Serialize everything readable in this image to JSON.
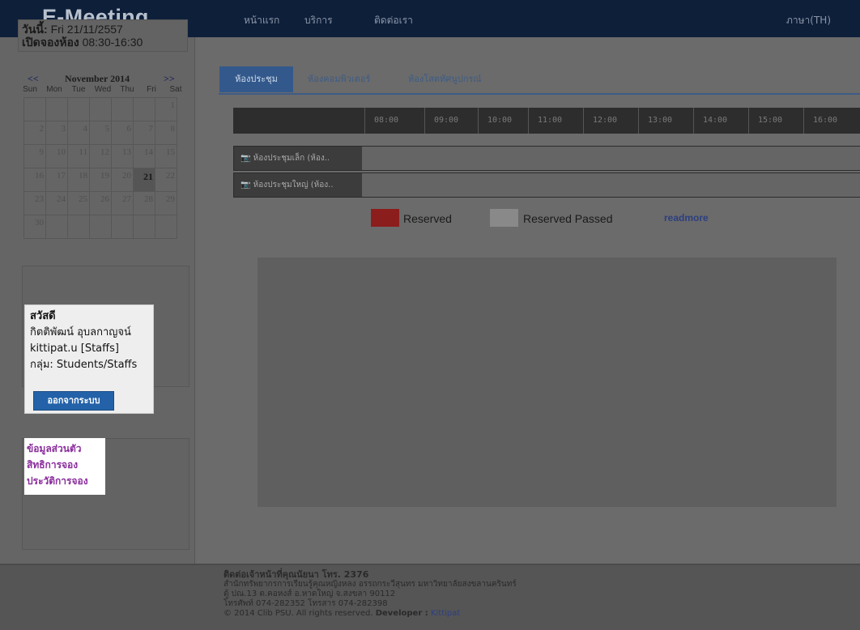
{
  "header": {
    "logo": "E-Meeting",
    "nav": [
      "หน้าแรก",
      "บริการ",
      "ติดต่อเรา"
    ],
    "language": "ภาษา(TH)"
  },
  "datebox": {
    "today_label": "วันนี้:",
    "today_value": "Fri 21/11/2557",
    "open_label": "เปิดจองห้อง",
    "open_value": "08:30-16:30"
  },
  "calendar": {
    "prev": "<<",
    "next": ">>",
    "month": "November 2014",
    "weekdays": [
      "Sun",
      "Mon",
      "Tue",
      "Wed",
      "Thu",
      "Fri",
      "Sat"
    ],
    "weeks": [
      [
        "",
        "",
        "",
        "",
        "",
        "",
        "1"
      ],
      [
        "2",
        "3",
        "4",
        "5",
        "6",
        "7",
        "8"
      ],
      [
        "9",
        "10",
        "11",
        "12",
        "13",
        "14",
        "15"
      ],
      [
        "16",
        "17",
        "18",
        "19",
        "20",
        "21",
        "22"
      ],
      [
        "23",
        "24",
        "25",
        "26",
        "27",
        "28",
        "29"
      ],
      [
        "30",
        "",
        "",
        "",
        "",
        "",
        ""
      ]
    ],
    "today": "21"
  },
  "user": {
    "greeting": "สวัสดี",
    "fullname": "กิตติพัฒน์ อุบลกาญจน์",
    "username": "kittipat.u [Staffs]",
    "group": "กลุ่ม: Students/Staffs",
    "logout_label": "ออกจากระบบ"
  },
  "links": [
    "ข้อมูลส่วนตัว",
    "สิทธิการจอง",
    "ประวัติการจอง"
  ],
  "tabs": [
    "ห้องประชุม",
    "ห้องคอมพิวเตอร์",
    "ห้องโสตทัศนูปกรณ์"
  ],
  "times": [
    "08:00",
    "09:00",
    "10:00",
    "11:00",
    "12:00",
    "13:00",
    "14:00",
    "15:00",
    "16:00"
  ],
  "rooms": [
    "ห้องประชุมเล็ก (ห้อง..",
    "ห้องประชุมใหญ่ (ห้อง.."
  ],
  "legend": {
    "reserved": "Reserved",
    "reserved_passed": "Reserved Passed",
    "readmore": "readmore",
    "reserved_color": "#8c1d1d",
    "passed_color": "#898989"
  },
  "footer": {
    "line1": "ติดต่อเจ้าหน้าที่คุณนัยนา โทร. 2376",
    "line2": "สำนักทรัพยากรการเรียนรู้คุณหญิงหลง อรรถกระวีสุนทร มหาวิทยาลัยสงขลานครินทร์",
    "line3": "ตู้ ปณ.13 ต.คอหงส์ อ.หาดใหญ่ จ.สงขลา 90112",
    "line4": "โทรศัพท์ 074-282352 โทรสาร 074-282398",
    "line5": "© 2014 Clib PSU. All rights reserved.",
    "developer_label": "Developer :",
    "developer_name": "Kittipat"
  }
}
